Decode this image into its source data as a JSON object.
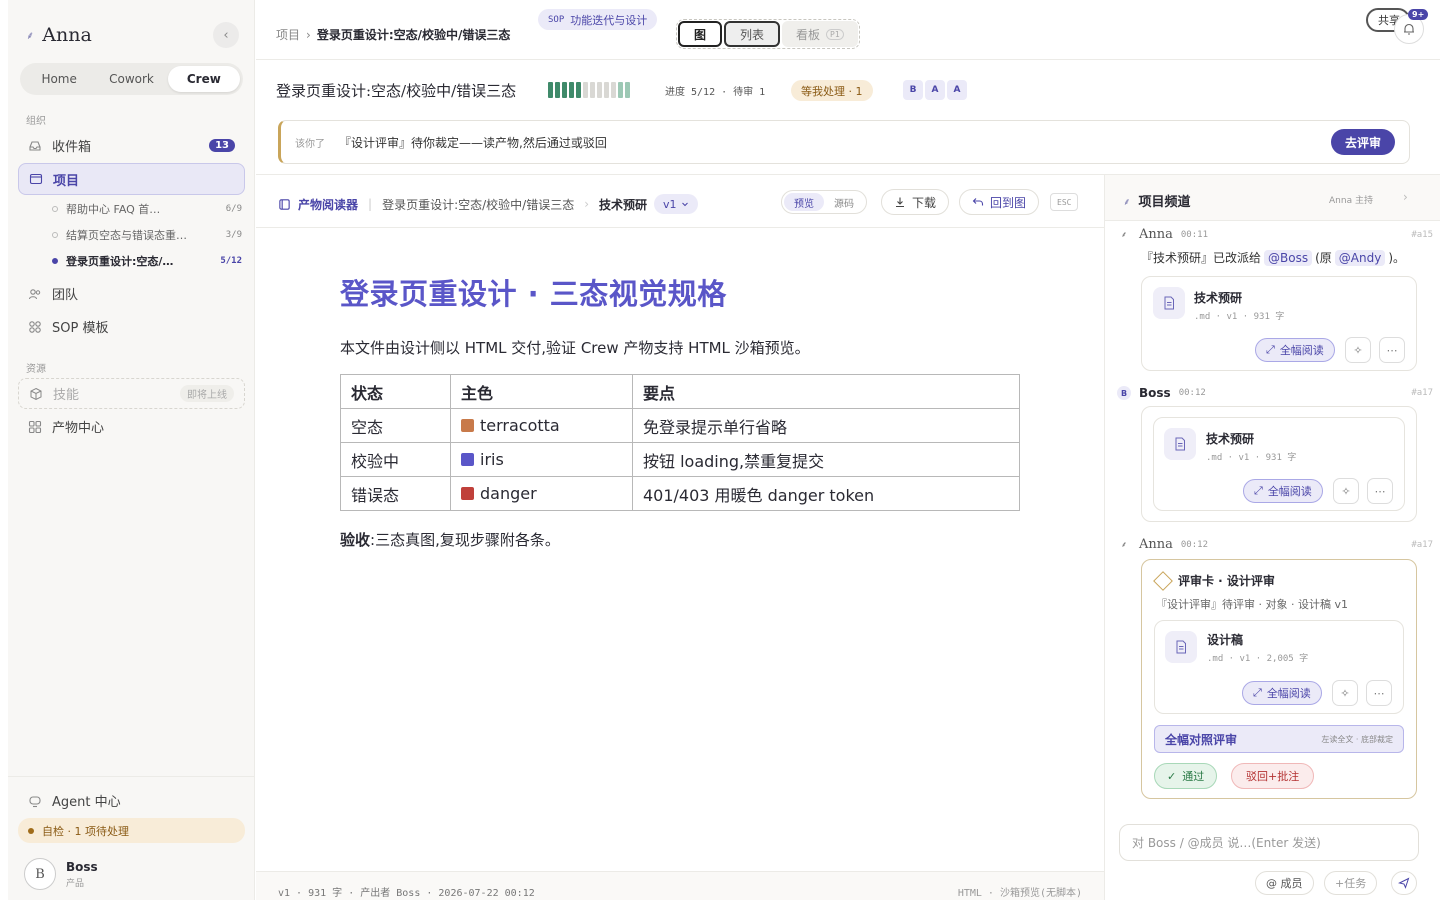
{
  "sidebar": {
    "brand_glyph": "⸙",
    "brand_name": "Anna",
    "collapse_glyph": "‹",
    "tabs": [
      {
        "label": "Home"
      },
      {
        "label": "Cowork"
      },
      {
        "label": "Crew"
      }
    ],
    "org_label": "组织",
    "inbox": {
      "label": "收件箱",
      "badge": "13"
    },
    "projects": {
      "label": "项目"
    },
    "project_items": [
      {
        "label": "帮助中心 FAQ 首…",
        "count": "6/9"
      },
      {
        "label": "结算页空态与错误态重…",
        "count": "3/9"
      },
      {
        "label": "登录页重设计:空态/…",
        "count": "5/12"
      }
    ],
    "team": {
      "label": "团队"
    },
    "sop": {
      "label": "SOP 模板"
    },
    "res_label": "资源",
    "skills": {
      "label": "技能",
      "soon": "即将上线"
    },
    "artifacts": {
      "label": "产物中心"
    },
    "agent_center": {
      "label": "Agent 中心"
    },
    "selfcheck": "自检 · 1 项待处理",
    "user": {
      "initial": "B",
      "name": "Boss",
      "role": "产品"
    }
  },
  "topbar": {
    "crumb_root": "项目",
    "crumb_sep": "›",
    "crumb_current": "登录页重设计:空态/校验中/错误三态",
    "sop_tag": "SOP",
    "sop_label": "功能迭代与设计",
    "views": {
      "graph": "图",
      "list": "列表",
      "board": "看板",
      "board_tag": "P1"
    },
    "share_label": "共享",
    "bell_badge": "9+"
  },
  "project": {
    "title": "登录页重设计:空态/校验中/错误三态",
    "progress": {
      "done": 5,
      "total": 12
    },
    "progress_text": "进度 5/12 · 待审 1",
    "wait_pill": "等我处理 · 1",
    "members": [
      "B",
      "A",
      "A"
    ]
  },
  "notice": {
    "who": "该你了",
    "message": "『设计评审』待你裁定——读产物,然后通过或驳回",
    "action": "去评审"
  },
  "reader": {
    "title": "产物阅读器",
    "doc_path": "登录页重设计:空态/校验中/错误三态",
    "sep": "›",
    "current": "技术预研",
    "version": "v1",
    "mode_preview": "预览",
    "mode_source": "源码",
    "download": "下载",
    "back": "回到图",
    "esc": "ESC",
    "doc": {
      "h1": "登录页重设计 · 三态视觉规格",
      "intro": "本文件由设计侧以 HTML 交付,验证 Crew 产物支持 HTML 沙箱预览。",
      "headers": [
        "状态",
        "主色",
        "要点"
      ],
      "rows": [
        {
          "state": "空态",
          "color_name": "terracotta",
          "color": "#c87a4a",
          "note": "免登录提示单行省略"
        },
        {
          "state": "校验中",
          "color_name": "iris",
          "color": "#5a56c8",
          "note": "按钮 loading,禁重复提交"
        },
        {
          "state": "错误态",
          "color_name": "danger",
          "color": "#c0403a",
          "note": "401/403 用暖色 danger token"
        }
      ],
      "accept_label": "验收",
      "accept_text": ":三态真图,复现步骤附各条。"
    },
    "footer_left": "v1 · 931 字 · 产出者 Boss · 2026-07-22 00:12",
    "footer_right": "HTML · 沙箱预览(无脚本)"
  },
  "channel": {
    "title": "项目频道",
    "meta": "Anna 主持",
    "arrow": "›",
    "messages": [
      {
        "name": "Anna",
        "time": "00:11",
        "ref": "#a15",
        "text_pre": "『技术预研』已改派给",
        "mention1": "@Boss",
        "text_mid": "(原",
        "mention2": "@Andy",
        "text_post": ")。",
        "file": {
          "name": "技术预研",
          "meta": ".md · v1 · 931 字"
        },
        "read": "全幅阅读"
      },
      {
        "name": "Boss",
        "time": "00:12",
        "ref": "#a17",
        "file": {
          "name": "技术预研",
          "meta": ".md · v1 · 931 字"
        },
        "read": "全幅阅读"
      },
      {
        "name": "Anna",
        "time": "00:12",
        "ref": "#a17",
        "card_title": "评审卡 · 设计评审",
        "card_sub": "『设计评审』待评审 · 对象 · 设计稿 v1",
        "file": {
          "name": "设计稿",
          "meta": ".md · v1 · 2,005 字"
        },
        "read": "全幅阅读",
        "compare": "全幅对照评审",
        "compare_hint": "左读全文 · 底部裁定",
        "pass": "通过",
        "reject": "驳回+批注"
      }
    ],
    "composer_placeholder": "对 Boss / @成员 说…(Enter 发送)",
    "member_btn": "@ 成员",
    "task_btn": "+任务"
  }
}
